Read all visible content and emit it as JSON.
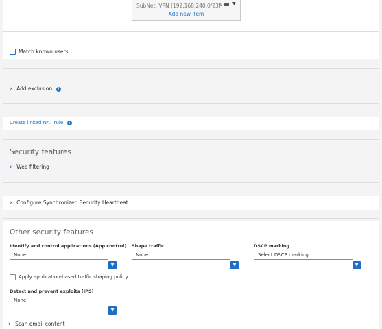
{
  "top_list": {
    "row_text": "SubNet: VPN (192.168.240.0/23)",
    "add_new_item": "Add new item"
  },
  "match_known_users": {
    "label": "Match known users"
  },
  "add_exclusion": {
    "label": "Add exclusion"
  },
  "create_linked_nat_rule": {
    "label": "Create linked NAT rule"
  },
  "security_features": {
    "title": "Security features",
    "web_filtering": "Web filtering"
  },
  "heartbeat": {
    "label": "Configure Synchronized Security Heartbeat"
  },
  "other_security": {
    "title": "Other security features",
    "app_control": {
      "label": "Identify and control applications (App control)",
      "value": "None"
    },
    "shape_traffic": {
      "label": "Shape traffic",
      "value": "None"
    },
    "dscp": {
      "label": "DSCP marking",
      "placeholder": "Select DSCP marking"
    },
    "apply_shaping": {
      "label": "Apply application-based traffic shaping policy"
    },
    "ips": {
      "label": "Detect and prevent exploits (IPS)",
      "value": "None"
    },
    "scan_email": "Scan email content"
  },
  "colors": {
    "accent": "#1a73c8",
    "dropdown_button": "#1f6fc2",
    "background": "#f4f4f4"
  },
  "icons": [
    "info-icon",
    "chevron-right-icon",
    "chevron-down-icon",
    "arrow-down-icon"
  ]
}
